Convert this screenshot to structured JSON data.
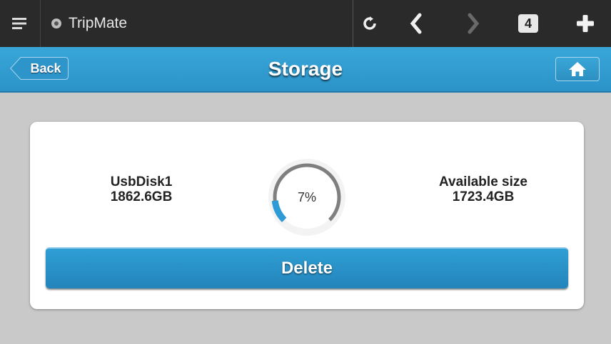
{
  "topbar": {
    "menu_icon": "hamburger-icon",
    "app_title": "TripMate",
    "tab_count": "4",
    "icons": [
      "refresh-icon",
      "back-arrow-icon",
      "forward-arrow-icon",
      "plus-icon"
    ]
  },
  "header": {
    "back_label": "Back",
    "title": "Storage",
    "home_icon": "home-icon"
  },
  "storage": {
    "disk_name": "UsbDisk1",
    "disk_total": "1862.6GB",
    "usage_percent_label": "7%",
    "usage_fraction": 0.07,
    "available_label": "Available size",
    "available_value": "1723.4GB"
  },
  "actions": {
    "delete_label": "Delete"
  },
  "colors": {
    "accent": "#2b93c8",
    "topbar": "#2a2a2a",
    "background": "#c9c9c9"
  }
}
